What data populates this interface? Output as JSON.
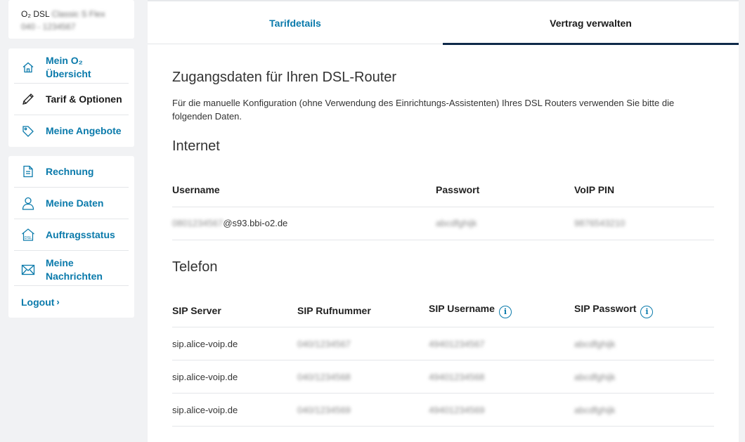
{
  "account": {
    "product": "O₂ DSL",
    "plan_blurred": "Classic S Flex",
    "number_blurred": "040 - 1234567"
  },
  "sidebar": {
    "group1": [
      {
        "label": "Mein O₂ Übersicht",
        "icon": "home-icon"
      },
      {
        "label": "Tarif & Optionen",
        "icon": "pencil-icon",
        "active": true
      },
      {
        "label": "Meine Angebote",
        "icon": "tag-icon"
      }
    ],
    "group2": [
      {
        "label": "Rechnung",
        "icon": "document-icon"
      },
      {
        "label": "Meine Daten",
        "icon": "person-icon"
      },
      {
        "label": "Auftragsstatus",
        "icon": "dsl-house-icon"
      },
      {
        "label": "Meine Nachrichten",
        "icon": "envelope-icon"
      }
    ],
    "logout": "Logout",
    "logout_chevron": "›"
  },
  "tabs": [
    {
      "label": "Tarifdetails",
      "active": false
    },
    {
      "label": "Vertrag verwalten",
      "active": true
    }
  ],
  "content": {
    "title": "Zugangsdaten für Ihren DSL-Router",
    "intro": "Für die manuelle Konfiguration (ohne Verwendung des Einrichtungs-Assistenten) Ihres DSL Routers verwenden Sie bitte die folgenden Daten.",
    "internet": {
      "title": "Internet",
      "headers": [
        "Username",
        "Passwort",
        "VoIP PIN"
      ],
      "row": {
        "username_blurred": "0801234567",
        "username_suffix": "@s93.bbi-o2.de",
        "password_blurred": "abcdfghijk",
        "voip_pin_blurred": "9876543210"
      }
    },
    "telefon": {
      "title": "Telefon",
      "headers": [
        "SIP Server",
        "SIP Rufnummer",
        "SIP Username",
        "SIP Passwort"
      ],
      "info_glyph": "i",
      "rows": [
        {
          "server": "sip.alice-voip.de",
          "rufnummer": "040/1234567",
          "username": "49401234567",
          "passwort": "abcdfghijk"
        },
        {
          "server": "sip.alice-voip.de",
          "rufnummer": "040/1234568",
          "username": "49401234568",
          "passwort": "abcdfghijk"
        },
        {
          "server": "sip.alice-voip.de",
          "rufnummer": "040/1234569",
          "username": "49401234569",
          "passwort": "abcdfghijk"
        }
      ]
    }
  },
  "colors": {
    "accent": "#0a7aab",
    "tab_underline": "#0f2a4a",
    "background": "#f1f2f4"
  }
}
